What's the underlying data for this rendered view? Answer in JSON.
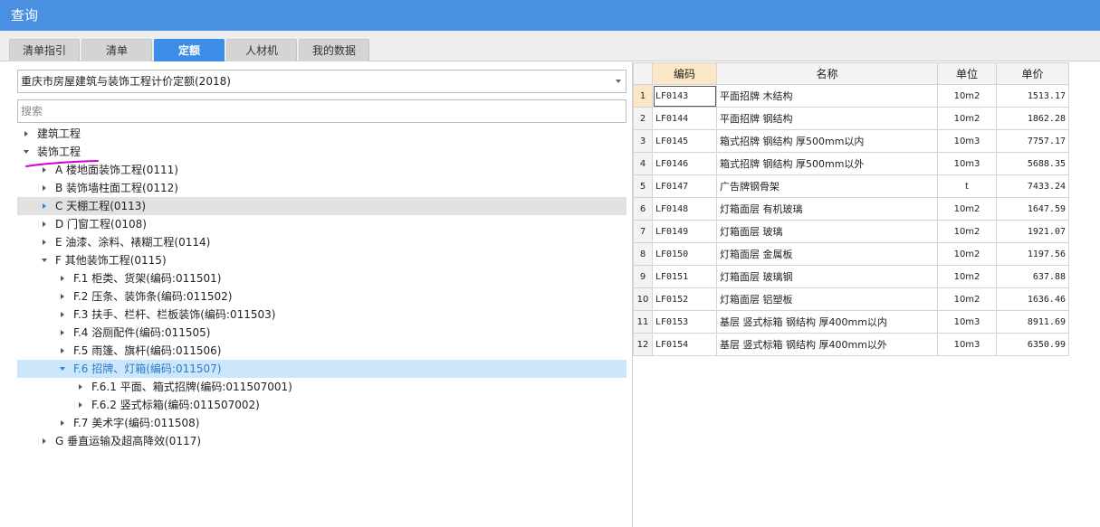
{
  "window": {
    "title": "查询"
  },
  "tabs": [
    {
      "label": "清单指引",
      "active": false
    },
    {
      "label": "清单",
      "active": false
    },
    {
      "label": "定额",
      "active": true
    },
    {
      "label": "人材机",
      "active": false
    },
    {
      "label": "我的数据",
      "active": false
    }
  ],
  "left": {
    "quota_select": "重庆市房屋建筑与装饰工程计价定额(2018)",
    "search_placeholder": "搜索",
    "tree": [
      {
        "label": "建筑工程",
        "expanded": false
      },
      {
        "label": "装饰工程",
        "expanded": true
      },
      {
        "label": "A 楼地面装饰工程(0111)",
        "expanded": false
      },
      {
        "label": "B 装饰墙柱面工程(0112)",
        "expanded": false
      },
      {
        "label": "C 天棚工程(0113)",
        "expanded": false
      },
      {
        "label": "D 门窗工程(0108)",
        "expanded": false
      },
      {
        "label": "E 油漆、涂料、裱糊工程(0114)",
        "expanded": false
      },
      {
        "label": "F 其他装饰工程(0115)",
        "expanded": true
      },
      {
        "label": "F.1 柜类、货架(编码:011501)",
        "expanded": false
      },
      {
        "label": "F.2 压条、装饰条(编码:011502)",
        "expanded": false
      },
      {
        "label": "F.3 扶手、栏杆、栏板装饰(编码:011503)",
        "expanded": false
      },
      {
        "label": "F.4 浴厕配件(编码:011505)",
        "expanded": false
      },
      {
        "label": "F.5 雨篷、旗杆(编码:011506)",
        "expanded": false
      },
      {
        "label": "F.6 招牌、灯箱(编码:011507)",
        "expanded": true
      },
      {
        "label": "F.6.1 平面、箱式招牌(编码:011507001)",
        "expanded": false
      },
      {
        "label": "F.6.2 竖式标箱(编码:011507002)",
        "expanded": false
      },
      {
        "label": "F.7 美术字(编码:011508)",
        "expanded": false
      },
      {
        "label": "G 垂直运输及超高降效(0117)",
        "expanded": false
      }
    ]
  },
  "grid": {
    "headers": {
      "code": "编码",
      "name": "名称",
      "unit": "单位",
      "price": "单价"
    },
    "rows": [
      {
        "idx": "1",
        "code": "LF0143",
        "name": "平面招牌 木结构",
        "unit": "10m2",
        "price": "1513.17"
      },
      {
        "idx": "2",
        "code": "LF0144",
        "name": "平面招牌 钢结构",
        "unit": "10m2",
        "price": "1862.28"
      },
      {
        "idx": "3",
        "code": "LF0145",
        "name": "箱式招牌 钢结构 厚500mm以内",
        "unit": "10m3",
        "price": "7757.17"
      },
      {
        "idx": "4",
        "code": "LF0146",
        "name": "箱式招牌 钢结构 厚500mm以外",
        "unit": "10m3",
        "price": "5688.35"
      },
      {
        "idx": "5",
        "code": "LF0147",
        "name": "广告牌钢骨架",
        "unit": "t",
        "price": "7433.24"
      },
      {
        "idx": "6",
        "code": "LF0148",
        "name": "灯箱面层 有机玻璃",
        "unit": "10m2",
        "price": "1647.59"
      },
      {
        "idx": "7",
        "code": "LF0149",
        "name": "灯箱面层 玻璃",
        "unit": "10m2",
        "price": "1921.07"
      },
      {
        "idx": "8",
        "code": "LF0150",
        "name": "灯箱面层 金属板",
        "unit": "10m2",
        "price": "1197.56"
      },
      {
        "idx": "9",
        "code": "LF0151",
        "name": "灯箱面层 玻璃钢",
        "unit": "10m2",
        "price": "637.88"
      },
      {
        "idx": "10",
        "code": "LF0152",
        "name": "灯箱面层 铝塑板",
        "unit": "10m2",
        "price": "1636.46"
      },
      {
        "idx": "11",
        "code": "LF0153",
        "name": "基层 竖式标箱 钢结构 厚400mm以内",
        "unit": "10m3",
        "price": "8911.69"
      },
      {
        "idx": "12",
        "code": "LF0154",
        "name": "基层 竖式标箱 钢结构 厚400mm以外",
        "unit": "10m3",
        "price": "6350.99"
      }
    ]
  },
  "colors": {
    "title_bar": "#4a90e2",
    "active_tab": "#3d8ee8",
    "selected_row": "#cce6fb",
    "hover_row": "#e1e1e1",
    "current_column": "#fbe7c6",
    "annotation": "#d000d0"
  }
}
